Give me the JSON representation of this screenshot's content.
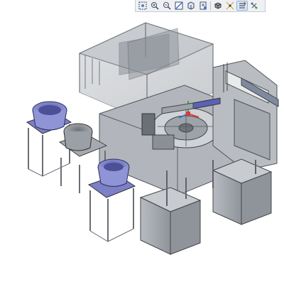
{
  "app": {
    "view": "3d-model-viewport",
    "background_color": "#ffffff"
  },
  "toolbar": {
    "buttons": [
      {
        "icon": "zoom-window-icon"
      },
      {
        "icon": "zoom-in-icon"
      },
      {
        "icon": "zoom-out-icon"
      },
      {
        "icon": "refit-icon"
      },
      {
        "icon": "saved-view-icon"
      },
      {
        "icon": "repaint-icon"
      },
      {
        "icon": "display-style-icon"
      },
      {
        "icon": "datum-display-icon"
      },
      {
        "icon": "spin-center-icon"
      },
      {
        "icon": "view-manager-icon"
      }
    ]
  },
  "model": {
    "frame_color": "#8c939a",
    "panel_color": "#b5b9bf",
    "bowl_color": "#7e84c8",
    "bin_color": "#a9adb3",
    "axis_colors": {
      "x": "#e0443b",
      "y": "#2bb24c",
      "z": "#3a6fd8"
    }
  }
}
